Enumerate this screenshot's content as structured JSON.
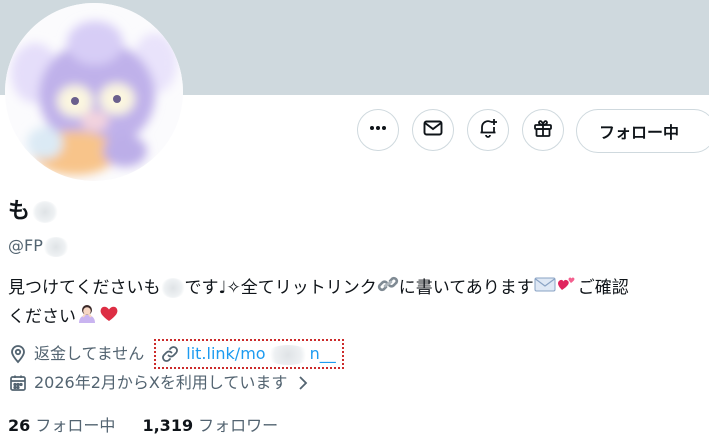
{
  "profile": {
    "name_visible": "も",
    "handle_visible": "@FP",
    "bio": {
      "part1": "見つけてくださいも",
      "part2": "です♩✧全てリットリンク",
      "part3": "に書いてあります",
      "part4": "ご確認",
      "part5": "ください"
    },
    "location": "返金してません",
    "link": {
      "part1": "lit.link/mo",
      "part2": "n__"
    },
    "joined": "2026年2月からXを利用しています",
    "following": {
      "count": "26",
      "label": "フォロー中"
    },
    "followers": {
      "count": "1,319",
      "label": "フォロワー"
    }
  },
  "actions": {
    "follow_label": "フォロー中",
    "more_icon": "more-icon",
    "message_icon": "mail-icon",
    "notify_icon": "bell-plus-icon",
    "gift_icon": "gift-icon"
  },
  "colors": {
    "banner": "#cfd9de",
    "link": "#1d9bf0",
    "text": "#0f1419",
    "muted": "#536471",
    "highlight_border": "#cc2b2b"
  }
}
